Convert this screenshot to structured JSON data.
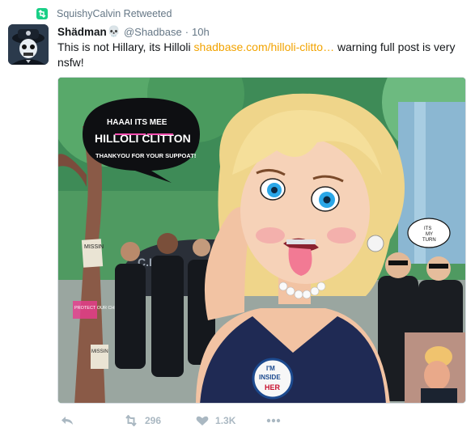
{
  "retweet_context": {
    "text": "SquishyCalvin Retweeted",
    "icon": "retweet-icon",
    "accent": "#19cf86"
  },
  "tweet": {
    "author": {
      "display_name": "Shädman",
      "emoji": "💀",
      "handle": "@Shadbase"
    },
    "separator": "·",
    "time": "10h",
    "text_before": "This is not Hillary, its Hilloli ",
    "link_text": "shadbase.com/hilloli-clitto…",
    "text_after": " warning full post is very nsfw!",
    "link_color": "#f2a300"
  },
  "media": {
    "bubble_lines": [
      "HAAAI ITS MEE",
      "HILLOLI CLITTON",
      "THANKYOU FOR YOUR SUPPOAT!"
    ],
    "bubble_highlight": [
      "LOLI",
      "CLIT"
    ],
    "badge_lines": [
      "I'M",
      "INSIDE",
      "HER"
    ],
    "car_text": "C.I.A",
    "poster_texts": [
      "MISSIN",
      "PROTECT OUR CHILDREN",
      "MISSIN"
    ],
    "small_bubble_lines": [
      "ITS",
      "MY",
      "TURN"
    ]
  },
  "actions": {
    "reply_icon": "reply-icon",
    "retweet_icon": "retweet-icon",
    "retweet_count": "296",
    "like_icon": "heart-icon",
    "like_count": "1.3K",
    "more_icon": "more-dots-icon"
  }
}
